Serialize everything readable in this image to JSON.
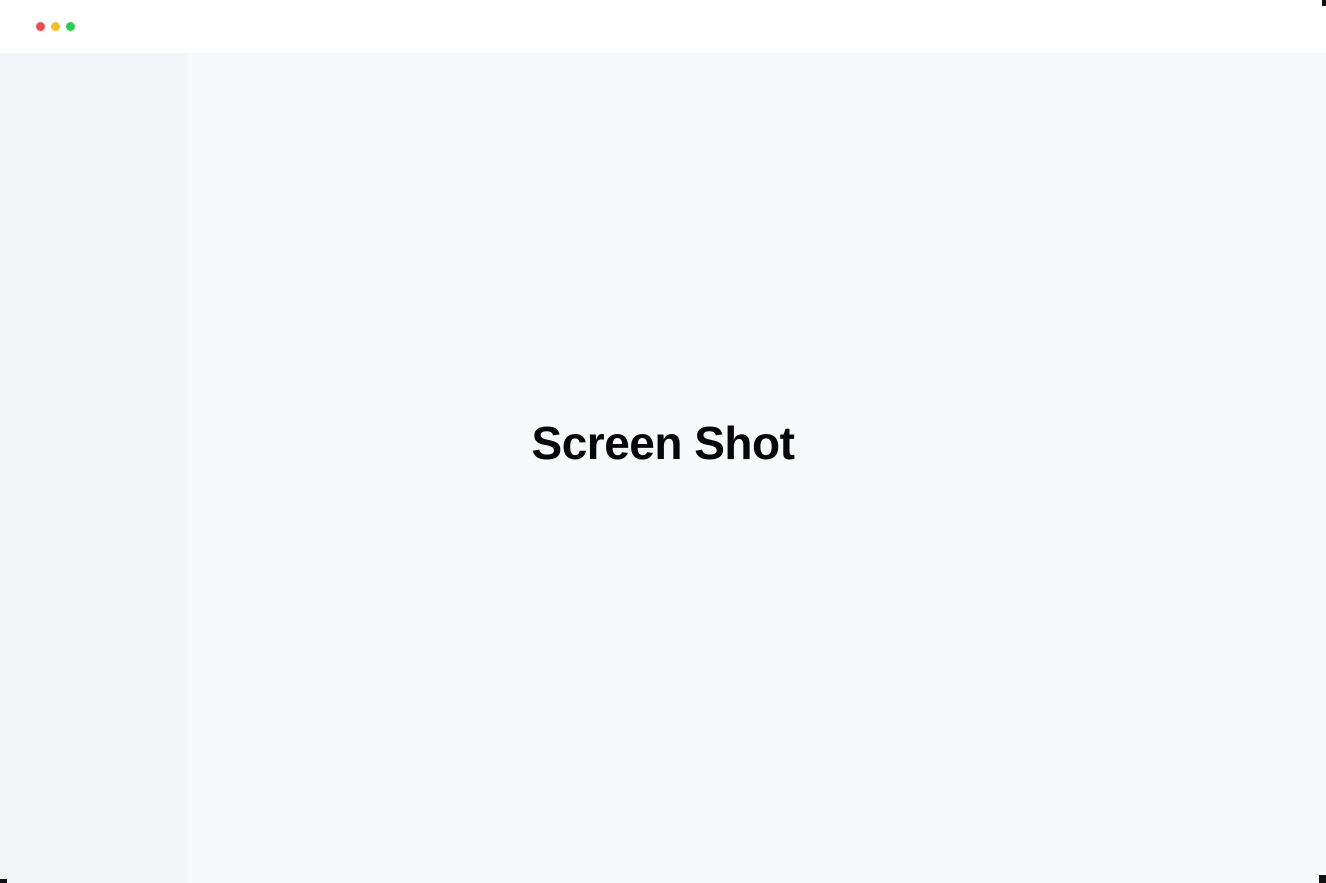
{
  "window": {
    "controls": [
      {
        "name": "close",
        "color": "#f04d4f"
      },
      {
        "name": "minimize",
        "color": "#f7bd24"
      },
      {
        "name": "maximize",
        "color": "#2fcc52"
      }
    ]
  },
  "main": {
    "title": "Screen Shot"
  }
}
